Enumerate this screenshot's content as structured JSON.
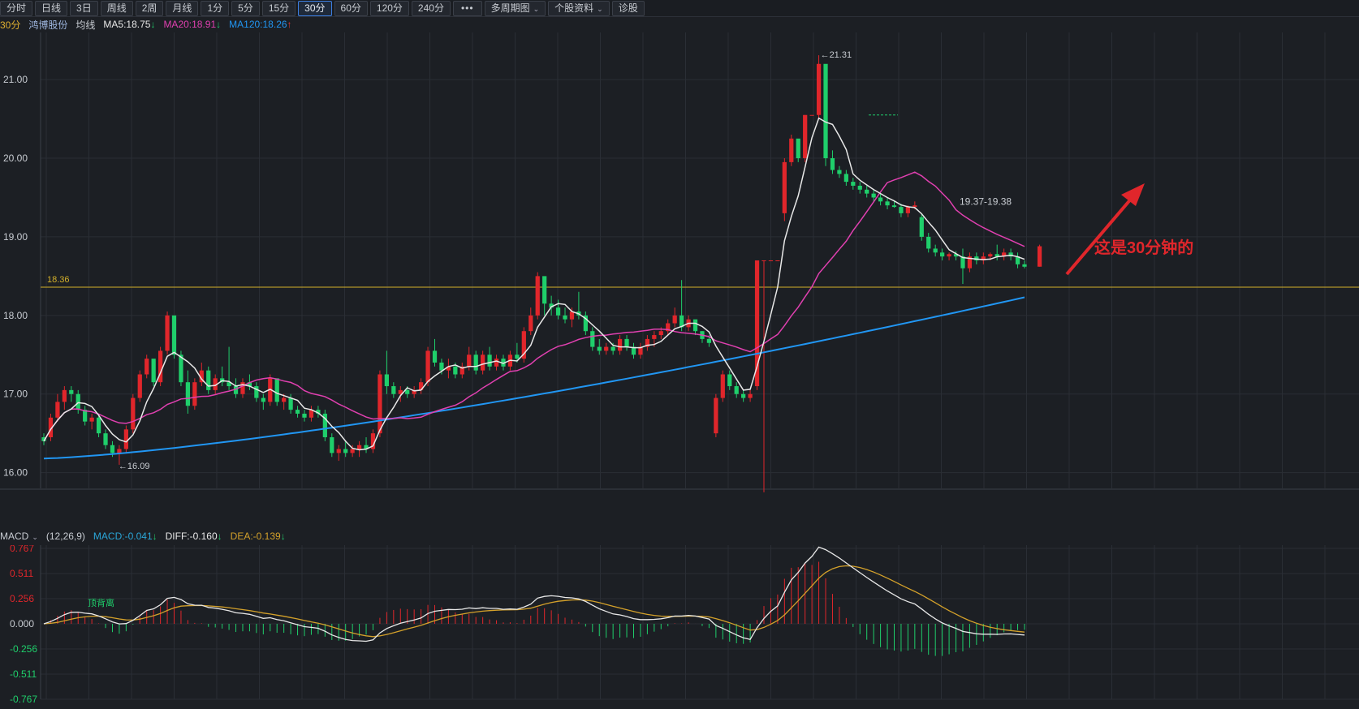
{
  "toolbar": {
    "buttons": [
      "分时",
      "日线",
      "3日",
      "周线",
      "2周",
      "月线",
      "1分",
      "5分",
      "15分",
      "30分",
      "60分",
      "120分",
      "240分",
      "•••",
      "多周期图",
      "个股资料",
      "诊股"
    ],
    "active_index": 9,
    "dropdown_indices": [
      14,
      15
    ]
  },
  "infobar": {
    "period": "30分",
    "stock_name": "鸿博股份",
    "mode": "均线",
    "ma5": "MA5:18.75",
    "ma5_dir": "↓",
    "ma20": "MA20:18.91",
    "ma20_dir": "↓",
    "ma120": "MA120:18.26",
    "ma120_dir": "↑",
    "ma5_color": "#e8e8e8",
    "ma20_color": "#e040b0",
    "ma120_color": "#2196f3"
  },
  "price_axis": {
    "ticks": [
      "21.00",
      "20.00",
      "19.00",
      "18.00",
      "17.00",
      "16.00"
    ],
    "ymin": 15.8,
    "ymax": 21.6
  },
  "annotations": {
    "high_label": "←21.31",
    "low_label": "←16.09",
    "range_label": "19.37-19.38",
    "hline_label": "18.36",
    "callout_text": "这是30分钟的",
    "callout_color": "#e0262b"
  },
  "macd": {
    "indicator": "MACD",
    "params": "(12,26,9)",
    "macd_value": "MACD:-0.041",
    "macd_dir": "↓",
    "diff_value": "DIFF:-0.160",
    "diff_dir": "↓",
    "dea_value": "DEA:-0.139",
    "dea_dir": "↓",
    "axis_ticks": [
      "0.767",
      "0.511",
      "0.256",
      "0.000",
      "-0.256",
      "-0.511",
      "-0.767"
    ],
    "annotation": "顶背离"
  },
  "colors": {
    "up": "#e0262b",
    "down": "#1fcf6b",
    "hline": "#d4b02a",
    "ma5": "#e8e8e8",
    "ma20": "#e040b0",
    "ma120": "#2196f3",
    "dea": "#d4a12a"
  },
  "chart_data": {
    "type": "candlestick",
    "title": "",
    "ylim": [
      15.8,
      21.6
    ],
    "hline": 18.36,
    "candles": [
      [
        16.45,
        16.5,
        16.35,
        16.4
      ],
      [
        16.45,
        16.75,
        16.4,
        16.7
      ],
      [
        16.7,
        17.0,
        16.65,
        16.9
      ],
      [
        16.9,
        17.1,
        16.8,
        17.05
      ],
      [
        17.05,
        17.1,
        16.9,
        17.0
      ],
      [
        17.0,
        17.05,
        16.75,
        16.8
      ],
      [
        16.8,
        16.85,
        16.6,
        16.65
      ],
      [
        16.65,
        16.75,
        16.55,
        16.7
      ],
      [
        16.7,
        16.72,
        16.45,
        16.5
      ],
      [
        16.5,
        16.55,
        16.3,
        16.35
      ],
      [
        16.35,
        16.4,
        16.2,
        16.25
      ],
      [
        16.25,
        16.35,
        16.1,
        16.3
      ],
      [
        16.3,
        16.6,
        16.25,
        16.55
      ],
      [
        16.55,
        17.0,
        16.5,
        16.95
      ],
      [
        16.95,
        17.3,
        16.9,
        17.25
      ],
      [
        17.25,
        17.5,
        17.2,
        17.45
      ],
      [
        17.45,
        17.4,
        17.1,
        17.15
      ],
      [
        17.15,
        17.6,
        17.1,
        17.55
      ],
      [
        17.55,
        18.05,
        17.5,
        18.0
      ],
      [
        18.0,
        17.95,
        17.45,
        17.5
      ],
      [
        17.5,
        17.55,
        17.1,
        17.15
      ],
      [
        17.15,
        17.3,
        16.75,
        16.85
      ],
      [
        16.85,
        17.2,
        16.8,
        17.15
      ],
      [
        17.15,
        17.4,
        17.1,
        17.3
      ],
      [
        17.3,
        17.35,
        17.0,
        17.05
      ],
      [
        17.05,
        17.25,
        17.0,
        17.2
      ],
      [
        17.2,
        17.35,
        17.1,
        17.15
      ],
      [
        17.15,
        17.6,
        17.05,
        17.1
      ],
      [
        17.1,
        17.2,
        16.95,
        17.0
      ],
      [
        17.0,
        17.2,
        16.95,
        17.15
      ],
      [
        17.15,
        17.25,
        17.05,
        17.1
      ],
      [
        17.1,
        17.15,
        16.9,
        16.95
      ],
      [
        16.95,
        17.0,
        16.8,
        16.9
      ],
      [
        16.9,
        17.25,
        16.85,
        17.2
      ],
      [
        17.2,
        17.1,
        16.85,
        16.9
      ],
      [
        16.9,
        17.0,
        16.8,
        16.95
      ],
      [
        16.95,
        17.0,
        16.75,
        16.8
      ],
      [
        16.8,
        16.85,
        16.7,
        16.75
      ],
      [
        16.75,
        16.8,
        16.65,
        16.7
      ],
      [
        16.7,
        16.85,
        16.65,
        16.8
      ],
      [
        16.8,
        16.85,
        16.7,
        16.75
      ],
      [
        16.75,
        16.8,
        16.4,
        16.45
      ],
      [
        16.45,
        16.5,
        16.2,
        16.25
      ],
      [
        16.25,
        16.35,
        16.15,
        16.3
      ],
      [
        16.3,
        16.4,
        16.2,
        16.25
      ],
      [
        16.25,
        16.35,
        16.2,
        16.3
      ],
      [
        16.3,
        16.4,
        16.2,
        16.35
      ],
      [
        16.35,
        16.45,
        16.25,
        16.3
      ],
      [
        16.3,
        16.55,
        16.25,
        16.5
      ],
      [
        16.5,
        17.3,
        16.45,
        17.25
      ],
      [
        17.25,
        17.55,
        17.0,
        17.1
      ],
      [
        17.1,
        17.15,
        16.95,
        17.0
      ],
      [
        17.0,
        17.1,
        16.9,
        17.05
      ],
      [
        17.05,
        17.1,
        16.95,
        17.0
      ],
      [
        17.0,
        17.1,
        16.95,
        17.05
      ],
      [
        17.05,
        17.2,
        17.0,
        17.15
      ],
      [
        17.15,
        17.6,
        17.1,
        17.55
      ],
      [
        17.55,
        17.7,
        17.35,
        17.4
      ],
      [
        17.4,
        17.45,
        17.25,
        17.3
      ],
      [
        17.3,
        17.45,
        17.2,
        17.35
      ],
      [
        17.35,
        17.4,
        17.2,
        17.25
      ],
      [
        17.25,
        17.4,
        17.2,
        17.35
      ],
      [
        17.35,
        17.6,
        17.3,
        17.5
      ],
      [
        17.5,
        17.55,
        17.25,
        17.3
      ],
      [
        17.3,
        17.55,
        17.25,
        17.5
      ],
      [
        17.5,
        17.6,
        17.3,
        17.35
      ],
      [
        17.35,
        17.5,
        17.3,
        17.45
      ],
      [
        17.45,
        17.5,
        17.3,
        17.35
      ],
      [
        17.35,
        17.55,
        17.3,
        17.5
      ],
      [
        17.5,
        17.65,
        17.4,
        17.45
      ],
      [
        17.45,
        17.85,
        17.4,
        17.8
      ],
      [
        17.8,
        18.1,
        17.75,
        18.0
      ],
      [
        18.0,
        18.55,
        17.95,
        18.5
      ],
      [
        18.5,
        18.2,
        18.0,
        18.15
      ],
      [
        18.15,
        18.25,
        18.0,
        18.1
      ],
      [
        18.1,
        18.2,
        17.95,
        18.0
      ],
      [
        18.0,
        18.1,
        17.9,
        17.95
      ],
      [
        17.95,
        18.1,
        17.85,
        18.05
      ],
      [
        18.05,
        18.3,
        17.95,
        18.0
      ],
      [
        18.0,
        18.05,
        17.75,
        17.8
      ],
      [
        17.8,
        17.85,
        17.55,
        17.6
      ],
      [
        17.6,
        17.7,
        17.5,
        17.55
      ],
      [
        17.55,
        17.65,
        17.5,
        17.6
      ],
      [
        17.6,
        17.65,
        17.5,
        17.55
      ],
      [
        17.55,
        17.75,
        17.5,
        17.7
      ],
      [
        17.7,
        17.75,
        17.55,
        17.6
      ],
      [
        17.6,
        17.65,
        17.45,
        17.5
      ],
      [
        17.5,
        17.65,
        17.45,
        17.6
      ],
      [
        17.6,
        17.75,
        17.55,
        17.7
      ],
      [
        17.7,
        17.8,
        17.6,
        17.75
      ],
      [
        17.75,
        17.85,
        17.7,
        17.8
      ],
      [
        17.8,
        17.95,
        17.75,
        17.9
      ],
      [
        17.9,
        18.1,
        17.85,
        18.0
      ],
      [
        18.0,
        18.45,
        17.8,
        17.85
      ],
      [
        17.85,
        18.0,
        17.8,
        17.95
      ],
      [
        17.95,
        17.9,
        17.75,
        17.8
      ],
      [
        17.8,
        17.8,
        17.65,
        17.7
      ],
      [
        17.7,
        17.75,
        17.6,
        17.65
      ],
      [
        16.5,
        17.0,
        16.45,
        16.95
      ],
      [
        16.95,
        17.3,
        16.9,
        17.25
      ],
      [
        17.25,
        17.3,
        17.05,
        17.1
      ],
      [
        17.1,
        17.15,
        16.95,
        17.0
      ],
      [
        17.0,
        17.05,
        16.9,
        16.95
      ],
      [
        16.95,
        17.05,
        16.9,
        17.0
      ],
      [
        17.1,
        18.7,
        17.05,
        18.7
      ],
      [
        18.7,
        18.7,
        15.75,
        18.7
      ],
      [
        18.7,
        18.7,
        18.7,
        18.7
      ],
      [
        18.7,
        18.7,
        18.7,
        18.7
      ],
      [
        19.3,
        20.0,
        19.2,
        19.95
      ],
      [
        19.95,
        20.3,
        19.9,
        20.25
      ],
      [
        20.25,
        20.2,
        19.95,
        20.0
      ],
      [
        20.0,
        20.55,
        19.95,
        20.55
      ],
      [
        20.55,
        20.55,
        20.55,
        20.55
      ],
      [
        20.55,
        21.31,
        20.5,
        21.2
      ],
      [
        21.2,
        20.4,
        19.9,
        20.0
      ],
      [
        20.0,
        20.1,
        19.8,
        19.85
      ],
      [
        19.85,
        19.9,
        19.75,
        19.8
      ],
      [
        19.8,
        19.85,
        19.65,
        19.7
      ],
      [
        19.7,
        19.75,
        19.6,
        19.65
      ],
      [
        19.65,
        19.7,
        19.55,
        19.6
      ],
      [
        19.6,
        19.65,
        19.5,
        19.55
      ],
      [
        19.55,
        19.6,
        19.45,
        19.5
      ],
      [
        19.5,
        19.55,
        19.4,
        19.45
      ],
      [
        19.45,
        19.5,
        19.35,
        19.4
      ],
      [
        19.4,
        19.45,
        19.37,
        19.38
      ],
      [
        19.38,
        19.42,
        19.25,
        19.3
      ],
      [
        19.3,
        19.4,
        19.25,
        19.38
      ],
      [
        19.38,
        19.45,
        19.35,
        19.4
      ],
      [
        19.25,
        19.3,
        18.95,
        19.0
      ],
      [
        19.0,
        19.05,
        18.8,
        18.85
      ],
      [
        18.85,
        18.9,
        18.75,
        18.8
      ],
      [
        18.8,
        18.85,
        18.7,
        18.75
      ],
      [
        18.75,
        18.8,
        18.7,
        18.78
      ],
      [
        18.78,
        18.82,
        18.7,
        18.75
      ],
      [
        18.75,
        18.85,
        18.4,
        18.6
      ],
      [
        18.6,
        18.8,
        18.55,
        18.75
      ],
      [
        18.75,
        18.8,
        18.65,
        18.7
      ],
      [
        18.7,
        18.8,
        18.65,
        18.75
      ],
      [
        18.75,
        18.8,
        18.7,
        18.78
      ],
      [
        18.78,
        18.9,
        18.7,
        18.75
      ],
      [
        18.75,
        18.85,
        18.7,
        18.8
      ],
      [
        18.8,
        18.85,
        18.7,
        18.75
      ],
      [
        18.75,
        18.8,
        18.6,
        18.65
      ],
      [
        18.65,
        18.7,
        18.6,
        18.62
      ]
    ],
    "extra_candle": [
      18.62,
      18.9,
      18.62,
      18.88
    ],
    "high": 21.31,
    "low": 16.09
  }
}
